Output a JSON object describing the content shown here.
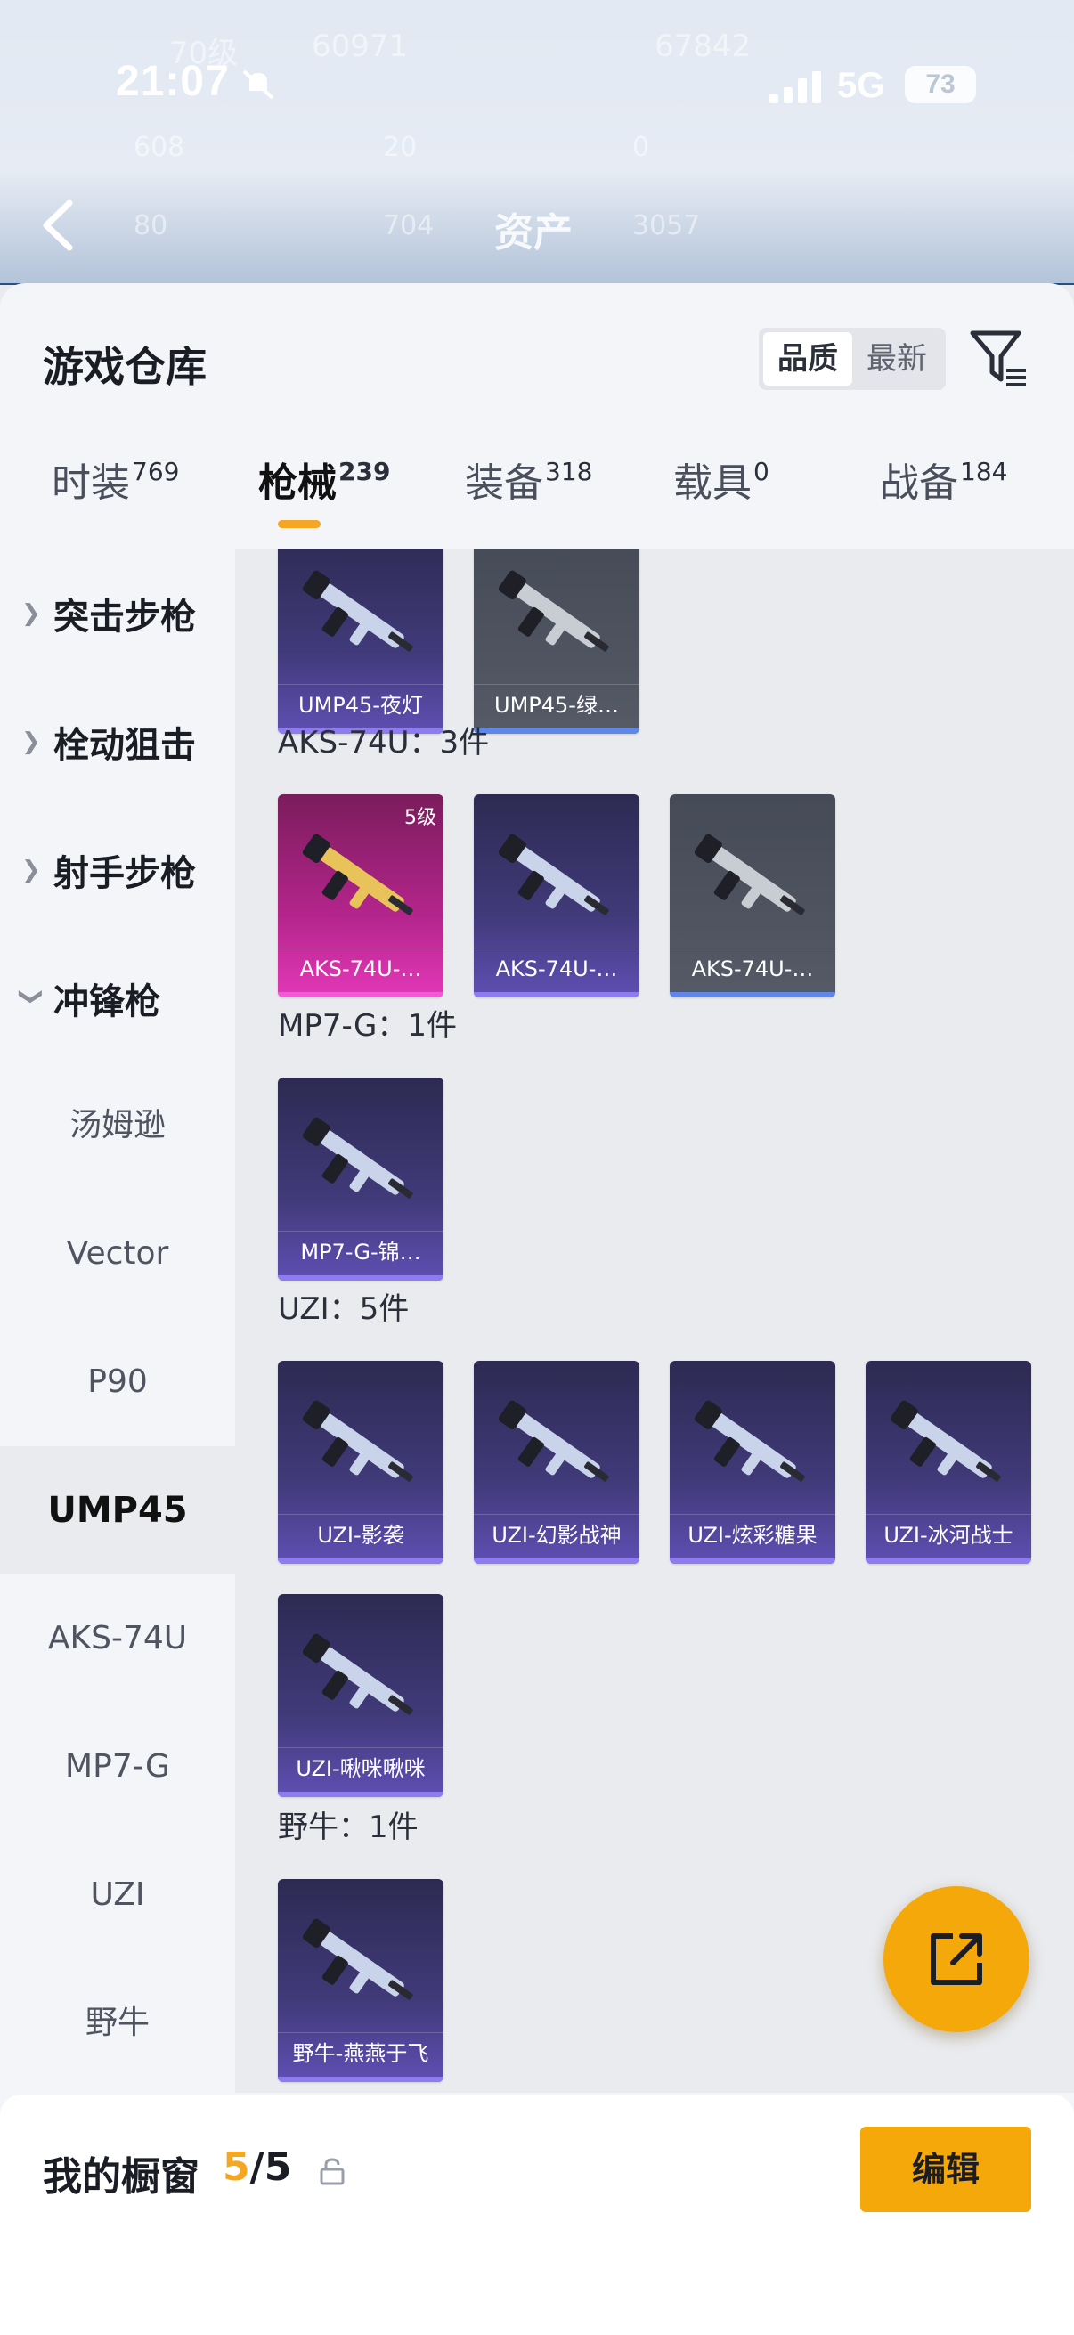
{
  "status": {
    "time": "21:07",
    "network": "5G",
    "battery": "73"
  },
  "background": {
    "title": "资产",
    "faded": [
      "70级",
      "60971",
      "67842",
      "608",
      "20",
      "0",
      "80",
      "704",
      "3057"
    ]
  },
  "sheet": {
    "title": "游戏仓库",
    "sort_options": [
      "品质",
      "最新"
    ],
    "tabs": [
      {
        "label": "时装",
        "count": "769"
      },
      {
        "label": "枪械",
        "count": "239"
      },
      {
        "label": "装备",
        "count": "318"
      },
      {
        "label": "载具",
        "count": "0"
      },
      {
        "label": "战备",
        "count": "184"
      }
    ]
  },
  "sidebar": {
    "categories": [
      "突击步枪",
      "栓动狙击",
      "射手步枪",
      "冲锋枪"
    ],
    "subitems": [
      "汤姆逊",
      "Vector",
      "P90",
      "UMP45",
      "AKS-74U",
      "MP7-G",
      "UZI",
      "野牛"
    ]
  },
  "groups": [
    {
      "title": "",
      "items": [
        {
          "name": "UMP45-夜灯",
          "style": "purple"
        },
        {
          "name": "UMP45-绿…",
          "style": "gray"
        }
      ]
    },
    {
      "title": "AKS-74U：3件",
      "items": [
        {
          "name": "AKS-74U-…",
          "style": "pink",
          "level": "5级"
        },
        {
          "name": "AKS-74U-…",
          "style": "purple"
        },
        {
          "name": "AKS-74U-…",
          "style": "gray"
        }
      ]
    },
    {
      "title": "MP7-G：1件",
      "items": [
        {
          "name": "MP7-G-锦…",
          "style": "purple"
        }
      ]
    },
    {
      "title": "UZI：5件",
      "items": [
        {
          "name": "UZI-影袭",
          "style": "purple"
        },
        {
          "name": "UZI-幻影战神",
          "style": "purple"
        },
        {
          "name": "UZI-炫彩糖果",
          "style": "purple"
        },
        {
          "name": "UZI-冰河战士",
          "style": "purple"
        },
        {
          "name": "UZI-啾咪啾咪",
          "style": "purple"
        }
      ]
    },
    {
      "title": "野牛：1件",
      "items": [
        {
          "name": "野牛-燕燕于飞",
          "style": "purple"
        }
      ]
    }
  ],
  "footer": {
    "label": "我的橱窗",
    "current": "5",
    "total": "/5",
    "edit": "编辑"
  },
  "colors": {
    "accent": "#f5a80a",
    "card_purple": "#413a7a",
    "card_pink": "#b4258c",
    "card_gray": "#555a66"
  }
}
